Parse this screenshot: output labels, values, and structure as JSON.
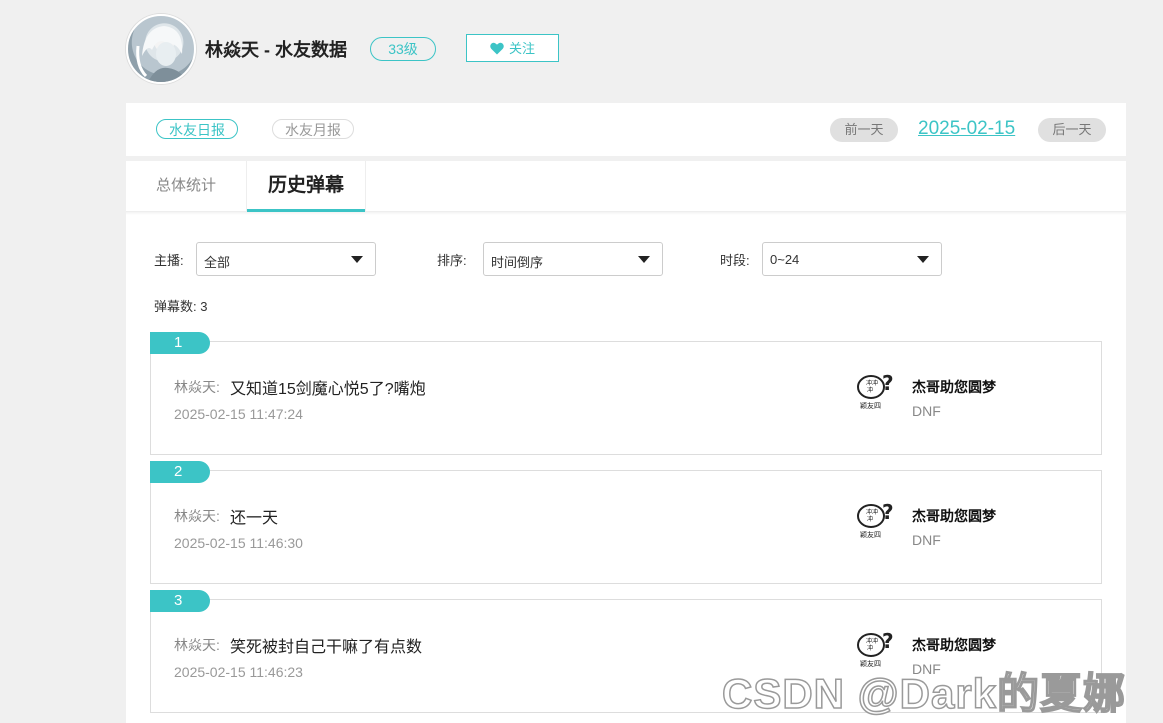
{
  "header": {
    "user_title": "林焱天 - 水友数据",
    "level": "33级",
    "follow_label": "关注"
  },
  "report_bar": {
    "daily_label": "水友日报",
    "monthly_label": "水友月报",
    "prev_label": "前一天",
    "date": "2025-02-15",
    "next_label": "后一天"
  },
  "tabs": [
    {
      "label": "总体统计"
    },
    {
      "label": "历史弹幕"
    }
  ],
  "filters": {
    "anchor": {
      "label": "主播:",
      "value": "全部"
    },
    "sort": {
      "label": "排序:",
      "value": "时间倒序"
    },
    "period": {
      "label": "时段:",
      "value": "0~24"
    }
  },
  "count_text": "弹幕数: 3",
  "messages": [
    {
      "num": "1",
      "author": "林焱天:",
      "text": "又知道15剑魔心悦5了?嘴炮",
      "time": "2025-02-15 11:47:24",
      "streamer": "杰哥助您圆梦",
      "game": "DNF"
    },
    {
      "num": "2",
      "author": "林焱天:",
      "text": "还一天",
      "time": "2025-02-15 11:46:30",
      "streamer": "杰哥助您圆梦",
      "game": "DNF"
    },
    {
      "num": "3",
      "author": "林焱天:",
      "text": "笑死被封自己干嘛了有点数",
      "time": "2025-02-15 11:46:23",
      "streamer": "杰哥助您圆梦",
      "game": "DNF"
    }
  ],
  "streamer_logo_text": "颖友四",
  "watermark": "CSDN @Dark的夏娜",
  "colors": {
    "accent": "#3cc4c6",
    "background": "#f0f0f0"
  }
}
